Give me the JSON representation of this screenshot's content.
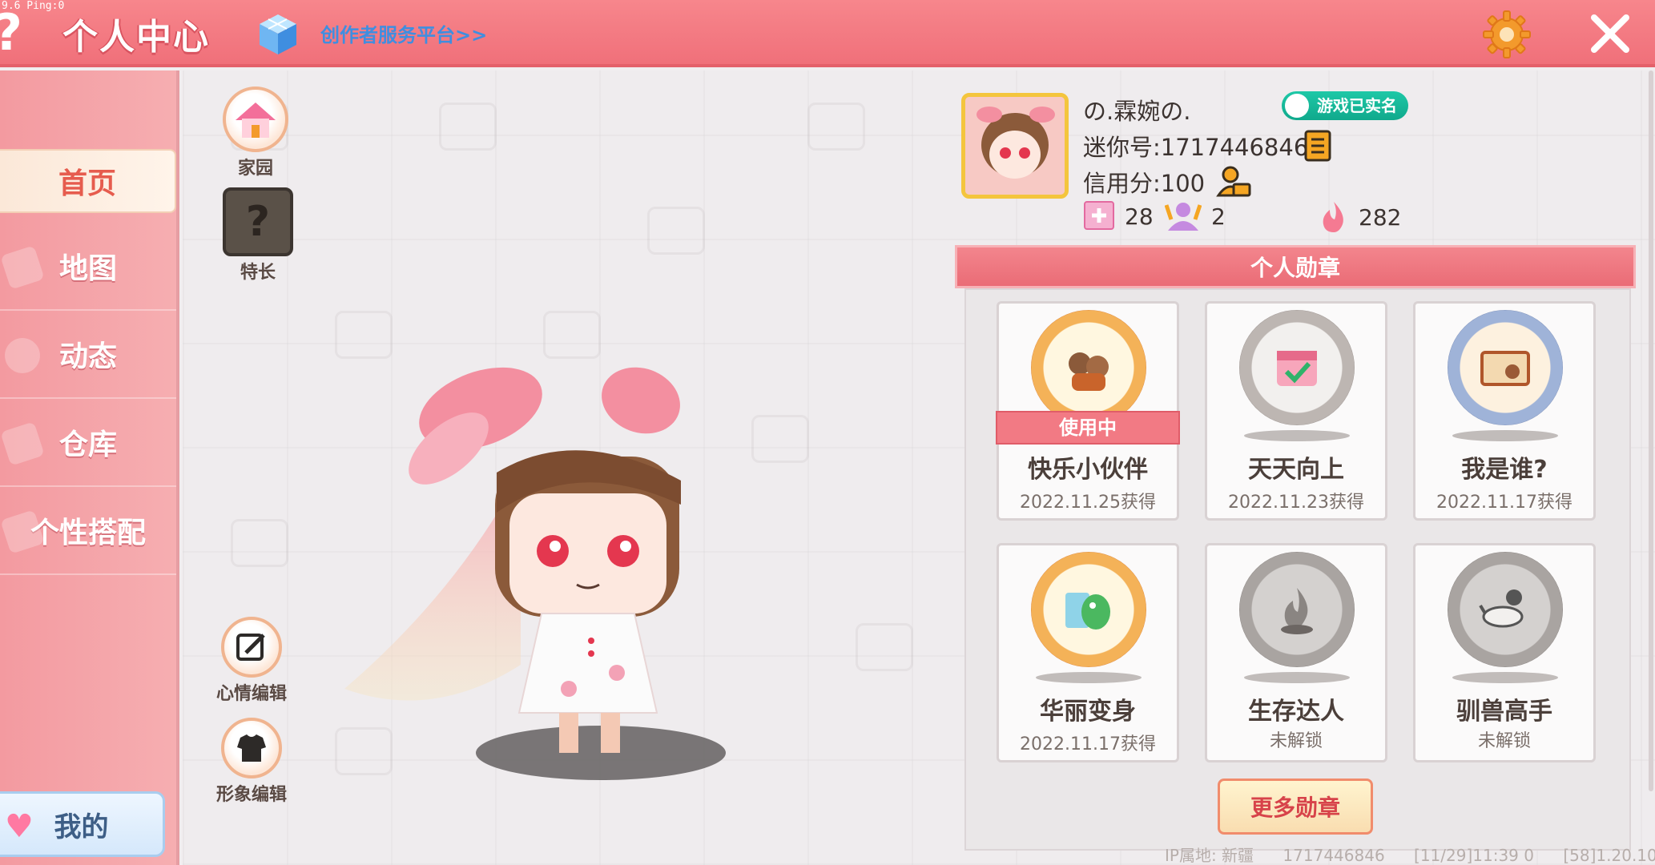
{
  "debug": "9.6 Ping:0",
  "header": {
    "title": "个人中心",
    "creator_link": "创作者服务平台>>",
    "icons": [
      "help-icon",
      "cube-icon",
      "gear-icon",
      "close-icon"
    ]
  },
  "sidebar": {
    "items": [
      {
        "label": "首页",
        "active": true
      },
      {
        "label": "地图"
      },
      {
        "label": "动态"
      },
      {
        "label": "仓库"
      },
      {
        "label": "个性搭配"
      }
    ],
    "my_tab": "我的"
  },
  "side_actions": {
    "home": "家园",
    "specialty": "特长",
    "mood_edit": "心情编辑",
    "avatar_edit": "形象编辑"
  },
  "profile": {
    "nickname": "の.霖婉の.",
    "verified": "游戏已实名",
    "mini_id": "迷你号:1717446846",
    "credit": "信用分:100",
    "stats": {
      "plus": "28",
      "fans": "2",
      "popularity": "282"
    }
  },
  "badges": {
    "title": "个人勋章",
    "in_use_label": "使用中",
    "items": [
      {
        "name": "快乐小伙伴",
        "date": "2022.11.25获得",
        "in_use": true
      },
      {
        "name": "天天向上",
        "date": "2022.11.23获得"
      },
      {
        "name": "我是谁?",
        "date": "2022.11.17获得"
      },
      {
        "name": "华丽变身",
        "date": "2022.11.17获得"
      },
      {
        "name": "生存达人",
        "date": "未解锁"
      },
      {
        "name": "驯兽高手",
        "date": "未解锁"
      }
    ],
    "more": "更多勋章"
  },
  "footer": {
    "ip": "IP属地: 新疆",
    "id": "1717446846",
    "time": "[11/29]11:39 0",
    "version": "[58]1.20.10"
  },
  "colors": {
    "accent": "#f0707a",
    "verified": "#10a98c",
    "gold": "#f4c53d"
  }
}
